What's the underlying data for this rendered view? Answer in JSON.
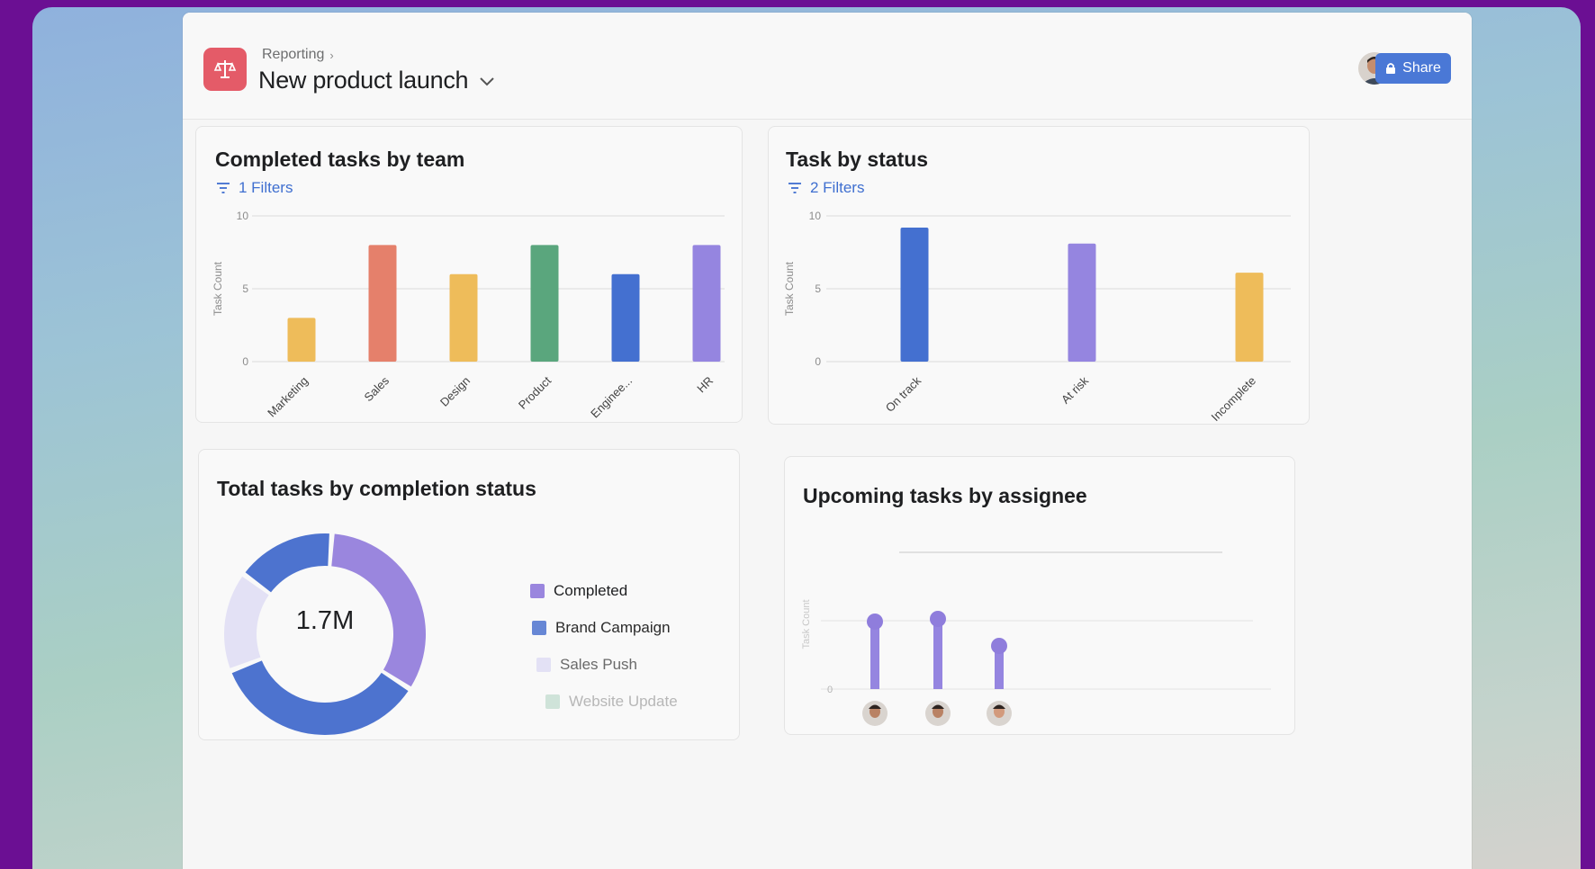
{
  "header": {
    "breadcrumb": "Reporting",
    "breadcrumb_sep": "›",
    "title": "New product launch",
    "share_label": "Share",
    "project_color": "#e45b68",
    "accent": "#4a78d6"
  },
  "cards": {
    "team": {
      "title": "Completed tasks by team",
      "filters": "1 Filters"
    },
    "status": {
      "title": "Task by status",
      "filters": "2 Filters"
    },
    "completion": {
      "title": "Total tasks by completion status",
      "center_value": "1.7M",
      "legend": [
        {
          "label": "Completed",
          "color": "#9a86de"
        },
        {
          "label": "Brand Campaign",
          "color": "#4d73cf"
        },
        {
          "label": "Sales Push",
          "color": "#e3e1f5"
        },
        {
          "label": "Website Update",
          "color": "#cfe3d9"
        }
      ]
    },
    "assignee": {
      "title": "Upcoming tasks by assignee",
      "ylabel": "Task Count",
      "ytick_zero": "0"
    }
  },
  "chart_data": [
    {
      "type": "bar",
      "title": "Completed tasks by team",
      "ylabel": "Task Count",
      "ylim": [
        0,
        10
      ],
      "yticks": [
        "0",
        "5",
        "10"
      ],
      "grid": true,
      "categories": [
        "Marketing",
        "Sales",
        "Design",
        "Product",
        "Enginee...",
        "HR"
      ],
      "values": [
        3,
        8,
        6,
        8,
        6,
        8
      ],
      "colors": [
        "#eebc5a",
        "#e5806b",
        "#eebc5a",
        "#5aa67d",
        "#4470d0",
        "#9585e0"
      ]
    },
    {
      "type": "bar",
      "title": "Task by status",
      "ylabel": "Task Count",
      "ylim": [
        0,
        10
      ],
      "yticks": [
        "0",
        "5",
        "10"
      ],
      "grid": true,
      "categories": [
        "On track",
        "At risk",
        "Incomplete"
      ],
      "values": [
        9.2,
        8.1,
        6.1
      ],
      "colors": [
        "#4470d0",
        "#9585e0",
        "#eebc5a"
      ]
    },
    {
      "type": "pie",
      "title": "Total tasks by completion status",
      "categories": [
        "Completed",
        "Brand Campaign",
        "Sales Push",
        "Website Update"
      ],
      "values": [
        33,
        35,
        16,
        16
      ],
      "colors": [
        "#9a86de",
        "#4d73cf",
        "#e3e1f5",
        "#4d73cf"
      ]
    },
    {
      "type": "bar",
      "title": "Upcoming tasks by assignee",
      "ylabel": "Task Count",
      "categories": [
        "",
        "",
        ""
      ],
      "values": [
        2.5,
        2.6,
        1.6
      ],
      "colors": [
        "#9585e0",
        "#9585e0",
        "#9585e0"
      ]
    }
  ]
}
